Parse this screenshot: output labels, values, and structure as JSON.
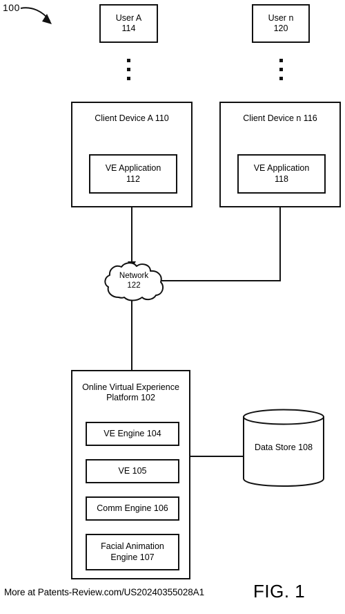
{
  "figure": {
    "reference_numeral": "100",
    "caption": "FIG. 1",
    "credit": "More at Patents-Review.com/US20240355028A1"
  },
  "users": [
    {
      "name": "user-a",
      "label": "User A\n114"
    },
    {
      "name": "user-n",
      "label": "User n\n120"
    }
  ],
  "client_devices": [
    {
      "name": "client-device-a",
      "title": "Client Device A 110",
      "application": "VE Application\n112"
    },
    {
      "name": "client-device-n",
      "title": "Client Device n 116",
      "application": "VE Application\n118"
    }
  ],
  "network": {
    "label": "Network\n122"
  },
  "platform": {
    "title": "Online Virtual Experience\nPlatform 102",
    "components": [
      {
        "name": "ve-engine",
        "label": "VE Engine 104"
      },
      {
        "name": "ve",
        "label": "VE 105"
      },
      {
        "name": "comm-engine",
        "label": "Comm Engine 106"
      },
      {
        "name": "facial-animation-engine",
        "label": "Facial Animation\nEngine 107"
      }
    ]
  },
  "data_store": {
    "label": "Data Store 108"
  },
  "colors": {
    "stroke": "#111111",
    "background": "#ffffff",
    "text": "#000000"
  }
}
